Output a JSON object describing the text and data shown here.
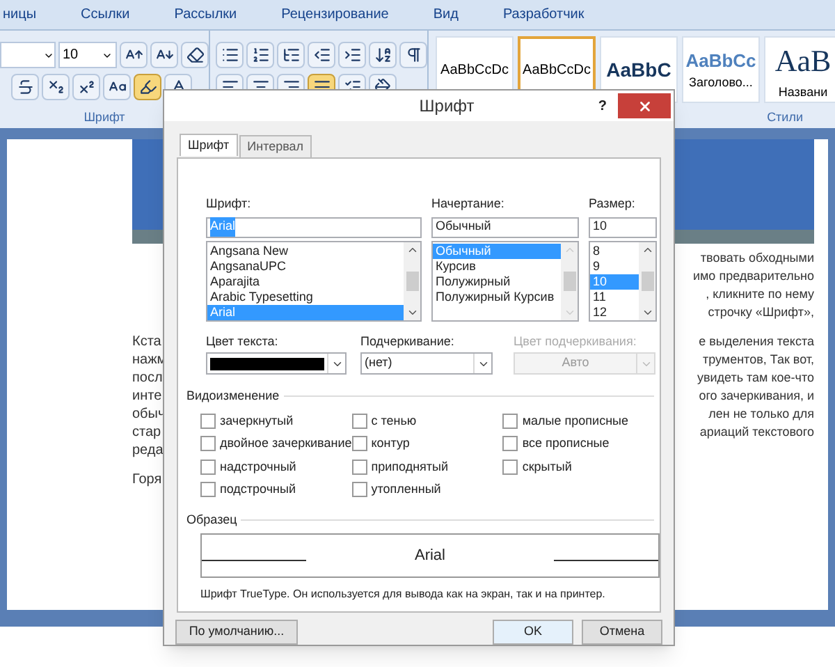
{
  "ribbon": {
    "tabs": [
      {
        "label": "ницы",
        "selected": false
      },
      {
        "label": "Ссылки",
        "selected": false
      },
      {
        "label": "Рассылки",
        "selected": false
      },
      {
        "label": "Рецензирование",
        "selected": false
      },
      {
        "label": "Вид",
        "selected": false
      },
      {
        "label": "Разработчик",
        "selected": false
      }
    ],
    "font_group": {
      "size": "10",
      "label": "Шрифт"
    },
    "styles": {
      "items": [
        {
          "sample": "AaBbCcDc",
          "selected": false,
          "kind": "normal"
        },
        {
          "sample": "AaBbCcDc",
          "selected": true,
          "kind": "normal"
        },
        {
          "sample": "AaBbC",
          "selected": false,
          "kind": "heading1"
        },
        {
          "sample": "AaBbCc",
          "caption": "Заголово...",
          "selected": false,
          "kind": "heading2"
        },
        {
          "sample": "AaB",
          "caption": "Названи",
          "selected": false,
          "kind": "title"
        }
      ],
      "label": "Стили"
    }
  },
  "document": {
    "paragraphs": [
      {
        "right": [
          "твовать обходными",
          "имо предварительно",
          ", кликните по нему",
          "строчку «Шрифт»,"
        ]
      },
      {
        "left": [
          "Кста",
          "нажм",
          "посл",
          "инте",
          "обыч",
          "стар",
          "реда"
        ],
        "right": [
          "е выделения текста",
          "трументов, Так вот,",
          "увидеть там кое-что",
          "ого зачеркивания, и",
          "лен не только для",
          "ариаций текстового"
        ]
      },
      {
        "left": [
          "Горя"
        ]
      }
    ]
  },
  "dialog": {
    "title": "Шрифт",
    "help": "?",
    "tabs": [
      {
        "label": "Шрифт",
        "selected": true
      },
      {
        "label": "Интервал",
        "selected": false
      }
    ],
    "font": {
      "label": "Шрифт:",
      "value": "Arial",
      "items": [
        {
          "label": "Angsana New",
          "selected": false
        },
        {
          "label": "AngsanaUPC",
          "selected": false
        },
        {
          "label": "Aparajita",
          "selected": false
        },
        {
          "label": "Arabic Typesetting",
          "selected": false
        },
        {
          "label": "Arial",
          "selected": true
        }
      ]
    },
    "style": {
      "label": "Начертание:",
      "value": "Обычный",
      "items": [
        {
          "label": "Обычный",
          "selected": true
        },
        {
          "label": "Курсив",
          "selected": false
        },
        {
          "label": "Полужирный",
          "selected": false
        },
        {
          "label": "Полужирный Курсив",
          "selected": false
        }
      ]
    },
    "size": {
      "label": "Размер:",
      "value": "10",
      "items": [
        {
          "label": "8",
          "selected": false
        },
        {
          "label": "9",
          "selected": false
        },
        {
          "label": "10",
          "selected": true
        },
        {
          "label": "11",
          "selected": false
        },
        {
          "label": "12",
          "selected": false
        }
      ]
    },
    "text_color": {
      "label": "Цвет текста:",
      "color": "#000000"
    },
    "underline": {
      "label": "Подчеркивание:",
      "value": "(нет)",
      "disabled": false
    },
    "underline_color": {
      "label": "Цвет подчеркивания:",
      "value": "Авто",
      "disabled": true
    },
    "effects_label": "Видоизменение",
    "effects": [
      [
        {
          "label": "зачеркнутый",
          "checked": false
        },
        {
          "label": "двойное зачеркивание",
          "checked": false
        },
        {
          "label": "надстрочный",
          "checked": false
        },
        {
          "label": "подстрочный",
          "checked": false
        }
      ],
      [
        {
          "label": "с тенью",
          "checked": false
        },
        {
          "label": "контур",
          "checked": false
        },
        {
          "label": "приподнятый",
          "checked": false
        },
        {
          "label": "утопленный",
          "checked": false
        }
      ],
      [
        {
          "label": "малые прописные",
          "checked": false
        },
        {
          "label": "все прописные",
          "checked": false
        },
        {
          "label": "скрытый",
          "checked": false
        }
      ]
    ],
    "preview_label": "Образец",
    "preview_text": "Arial",
    "note": "Шрифт TrueType. Он используется для вывода как на экран, так и на принтер.",
    "buttons": [
      {
        "label": "По умолчанию...",
        "kind": "default"
      },
      {
        "label": "OK",
        "kind": "primary"
      },
      {
        "label": "Отмена",
        "kind": "cancel"
      }
    ]
  }
}
